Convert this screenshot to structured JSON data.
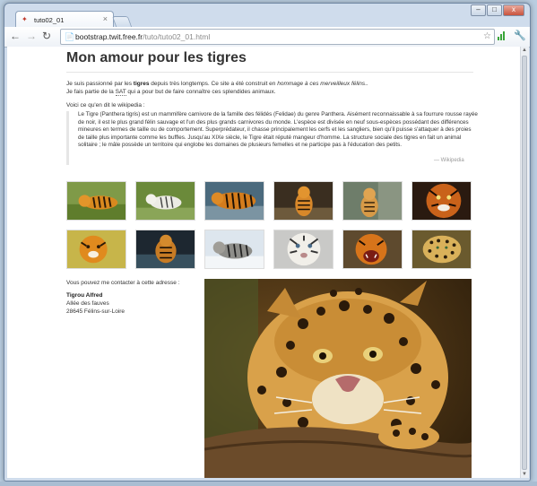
{
  "browser": {
    "tab_title": "tuto02_01",
    "tab_close": "×",
    "url_host": "bootstrap.twit.free.fr",
    "url_path": "/tuto/tuto02_01.html",
    "window_controls": {
      "minimize": "–",
      "maximize": "□",
      "close": "x"
    },
    "nav": {
      "back": "←",
      "forward": "→",
      "reload": "↻"
    },
    "icons": {
      "star": "☆",
      "wrench": "🔧",
      "page": "📄"
    }
  },
  "page": {
    "title": "Mon amour pour les tigres",
    "intro": {
      "p1_pre": "Je suis passionné par les ",
      "p1_bold": "tigres",
      "p1_mid": " depuis très longtemps. Ce site a été construit en ",
      "p1_em": "hommage à ces merveilleux félins",
      "p1_post": "..",
      "p2_pre": "Je fais partie de la ",
      "p2_abbr": "SAT",
      "p2_post": " qui a pour but de faire connaître ces splendides animaux."
    },
    "quote_lead": "Voici ce qu'en dit le wikipedia :",
    "quote_text": "Le Tigre (Panthera tigris) est un mammifère carnivore de la famille des félidés (Felidae) du genre Panthera. Aisément reconnaissable à sa fourrure rousse rayée de noir, il est le plus grand félin sauvage et l'un des plus grands carnivores du monde. L'espèce est divisée en neuf sous-espèces possédant des différences mineures en termes de taille ou de comportement. Superprédateur, il chasse principalement les cerfs et les sangliers, bien qu'il puisse s'attaquer à des proies de taille plus importante comme les buffles. Jusqu'au XIXe siècle, le Tigre était réputé mangeur d'homme. La structure sociale des tigres en fait un animal solitaire ; le mâle possède un territoire qui englobe les domaines de plusieurs femelles et ne participe pas à l'éducation des petits.",
    "quote_source": "— Wikipedia",
    "contact_intro": "Vous pouvez me contacter à cette adresse :",
    "address": {
      "name": "Tigrou Alfred",
      "street": "Allée des fauves",
      "city": "28645 Félins-sur-Loire"
    }
  },
  "colors": {
    "window_frame": "#cfdcec",
    "title_text": "#333333",
    "quote_border": "#e6e6e6",
    "muted": "#999999"
  }
}
